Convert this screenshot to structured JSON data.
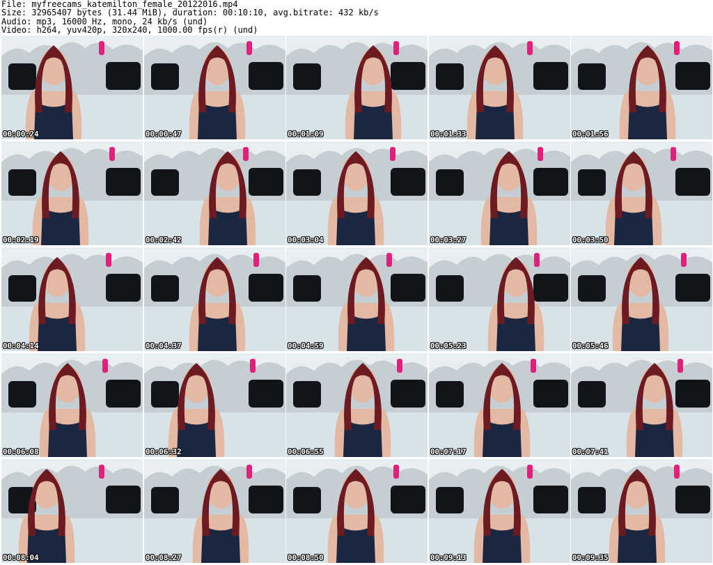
{
  "header": {
    "file_line": "File: myfreecams_katemilton_female_20122016.mp4",
    "size_line": "Size: 32965407 bytes (31.44 MiB), duration: 00:10:10, avg.bitrate: 432 kb/s",
    "audio_line": "Audio: mp3, 16000 Hz, mono, 24 kb/s (und)",
    "video_line": "Video: h264, yuv420p, 320x240, 1000.00 fps(r) (und)"
  },
  "thumbnails": [
    {
      "timestamp": "00:00:24"
    },
    {
      "timestamp": "00:00:47"
    },
    {
      "timestamp": "00:01:09"
    },
    {
      "timestamp": "00:01:33"
    },
    {
      "timestamp": "00:01:56"
    },
    {
      "timestamp": "00:02:19"
    },
    {
      "timestamp": "00:02:42"
    },
    {
      "timestamp": "00:03:04"
    },
    {
      "timestamp": "00:03:27"
    },
    {
      "timestamp": "00:03:50"
    },
    {
      "timestamp": "00:04:14"
    },
    {
      "timestamp": "00:04:37"
    },
    {
      "timestamp": "00:04:59"
    },
    {
      "timestamp": "00:05:23"
    },
    {
      "timestamp": "00:05:46"
    },
    {
      "timestamp": "00:06:08"
    },
    {
      "timestamp": "00:06:32"
    },
    {
      "timestamp": "00:06:55"
    },
    {
      "timestamp": "00:07:17"
    },
    {
      "timestamp": "00:07:41"
    },
    {
      "timestamp": "00:08:04"
    },
    {
      "timestamp": "00:08:27"
    },
    {
      "timestamp": "00:08:50"
    },
    {
      "timestamp": "00:09:13"
    },
    {
      "timestamp": "00:09:35"
    }
  ],
  "colors": {
    "wall": "#c5cfd3",
    "bed": "#d8e3e8",
    "pillow": "#111418",
    "accent_pink": "#e0207a",
    "hair": "#6e1a22",
    "skin": "#e4b9a3",
    "top": "#1b2740"
  }
}
